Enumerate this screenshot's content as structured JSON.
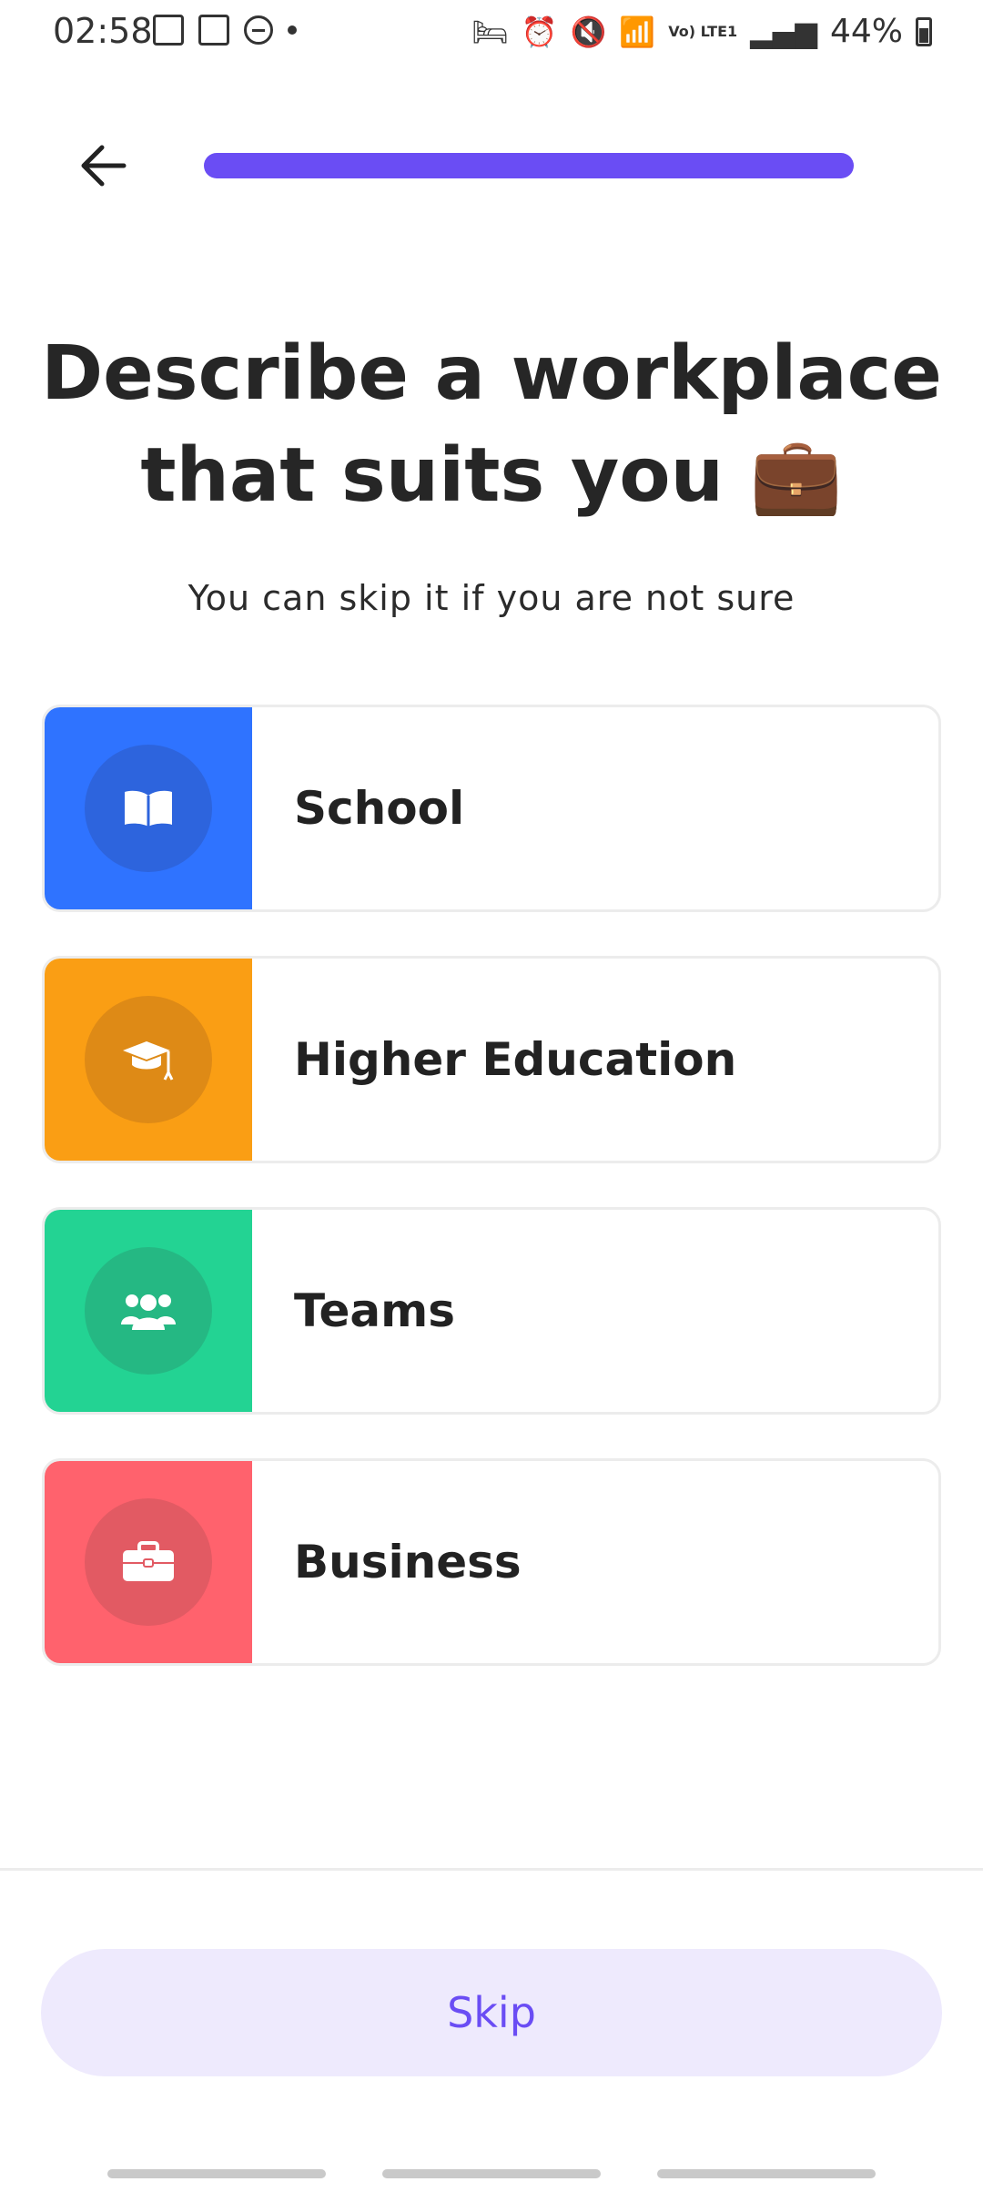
{
  "status_bar": {
    "time": "02:58",
    "battery": "44%",
    "network_label": "Vo) LTE1"
  },
  "header": {
    "progress": 1.0,
    "progress_color": "#6A4DF4"
  },
  "title": {
    "text": "Describe a workplace that suits you",
    "emoji": "💼"
  },
  "subtitle": "You can skip it if you are not sure",
  "options": [
    {
      "label": "School",
      "icon": "open-book-icon",
      "color": "#2F73FF",
      "circle": "#2D64DD"
    },
    {
      "label": "Higher Education",
      "icon": "graduation-cap-icon",
      "color": "#FA9E14",
      "circle": "#DE8A16"
    },
    {
      "label": "Teams",
      "icon": "people-group-icon",
      "color": "#23D393",
      "circle": "#25B883"
    },
    {
      "label": "Business",
      "icon": "briefcase-icon",
      "color": "#FF626D",
      "circle": "#E25A63"
    }
  ],
  "skip_label": "Skip"
}
